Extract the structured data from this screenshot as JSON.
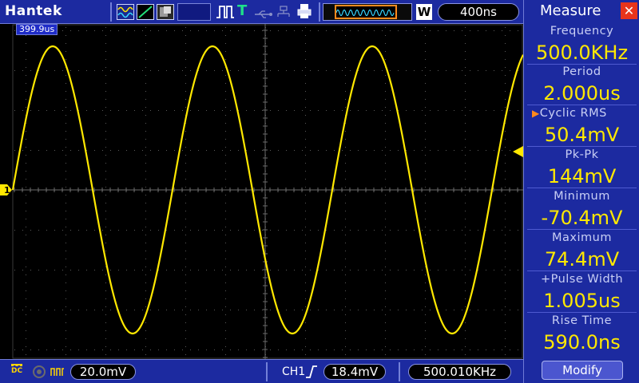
{
  "brand": "Hantek",
  "top": {
    "timebase": "400ns",
    "zoom_label": "W",
    "trigger_mode_label": "T",
    "cursor_time": "399.9us"
  },
  "waveform": {
    "channel": "CH1",
    "channel_marker": "1",
    "color": "#ffe800",
    "cycles_visible": 3.2,
    "amplitude_mV": 72,
    "volts_per_div_mV": 20
  },
  "bottom": {
    "coupling": "DC",
    "volts_div": "20.0mV",
    "trigger_channel": "CH1",
    "trigger_level": "18.4mV",
    "counter": "500.010KHz"
  },
  "measure": {
    "title": "Measure",
    "close": "✕",
    "items": [
      {
        "label": "Frequency",
        "value": "500.0KHz"
      },
      {
        "label": "Period",
        "value": "2.000us"
      },
      {
        "label": "Cyclic RMS",
        "value": "50.4mV",
        "selected": true
      },
      {
        "label": "Pk-Pk",
        "value": "144mV"
      },
      {
        "label": "Minimum",
        "value": "-70.4mV"
      },
      {
        "label": "Maximum",
        "value": "74.4mV"
      },
      {
        "label": "+Pulse Width",
        "value": "1.005us"
      },
      {
        "label": "Rise Time",
        "value": "590.0ns"
      }
    ],
    "modify": "Modify"
  },
  "colors": {
    "bar_blue": "#1c2aa0",
    "trace_yellow": "#ffe800",
    "accent_orange": "#ff8a1c",
    "close_red": "#e8341c",
    "trigger_green": "#1ee08a"
  }
}
